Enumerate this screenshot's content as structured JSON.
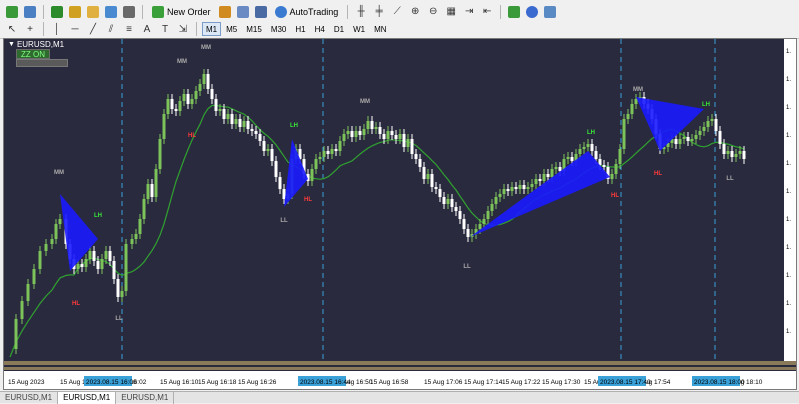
{
  "toolbar1": {
    "new_order_label": "New Order",
    "autotrading_label": "AutoTrading"
  },
  "toolbar2": {
    "timeframes": [
      "M1",
      "M5",
      "M15",
      "M30",
      "H1",
      "H4",
      "D1",
      "W1",
      "MN"
    ],
    "active_timeframe": "M1"
  },
  "chart": {
    "symbol_title": "EURUSD,M1",
    "zz_button": "ZZ ON",
    "candle_up_color": "#7cc35a",
    "candle_down_color": "#ffffff",
    "ma_color": "#2fa22f",
    "triangle_color": "#1a1aff",
    "separator_color": "#3aa0d8",
    "labels": [
      {
        "text": "MM",
        "color": "#aaaaaa"
      },
      {
        "text": "MM",
        "color": "#aaaaaa"
      },
      {
        "text": "MM",
        "color": "#aaaaaa"
      },
      {
        "text": "MM",
        "color": "#aaaaaa"
      },
      {
        "text": "MM",
        "color": "#aaaaaa"
      },
      {
        "text": "LH",
        "color": "#38e838"
      },
      {
        "text": "LH",
        "color": "#38e838"
      },
      {
        "text": "LH",
        "color": "#38e838"
      },
      {
        "text": "LH",
        "color": "#38e838"
      },
      {
        "text": "HL",
        "color": "#ff3a3a"
      },
      {
        "text": "HL",
        "color": "#ff3a3a"
      },
      {
        "text": "HL",
        "color": "#ff3a3a"
      },
      {
        "text": "HL",
        "color": "#ff3a3a"
      },
      {
        "text": "HL",
        "color": "#ff3a3a"
      },
      {
        "text": "LL",
        "color": "#aaaaaa"
      },
      {
        "text": "LL",
        "color": "#aaaaaa"
      },
      {
        "text": "LL",
        "color": "#aaaaaa"
      },
      {
        "text": "LL",
        "color": "#aaaaaa"
      }
    ],
    "time_axis": [
      "15 Aug 2023",
      "15 Aug 15:46",
      "15 Aug 16:02",
      "15 Aug 16:10",
      "15 Aug 16:18",
      "15 Aug 16:26",
      "15 Aug 16:50",
      "15 Aug 16:58",
      "15 Aug 17:06",
      "15 Aug 17:14",
      "15 Aug 17:22",
      "15 Aug 17:30",
      "15 Aug 17:46",
      "15 Aug 17:54",
      "15 Aug 18:10"
    ],
    "session_markers": [
      "2023.08.15 16:00",
      "2023.08.15 16:44",
      "2023.08.15 17:40",
      "2023.08.15 18:00"
    ]
  },
  "tabs": [
    "EURUSD,M1",
    "EURUSD,M1",
    "EURUSD,M1"
  ],
  "active_tab": 1
}
